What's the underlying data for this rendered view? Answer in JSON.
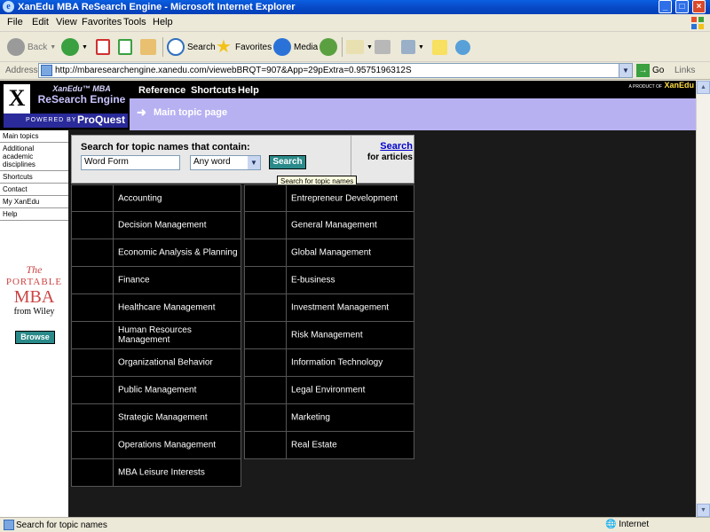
{
  "window": {
    "title": "XanEdu MBA ReSearch Engine - Microsoft Internet Explorer"
  },
  "menu": [
    "File",
    "Edit",
    "View",
    "Favorites",
    "Tools",
    "Help"
  ],
  "toolbar": {
    "back": "Back",
    "search": "Search",
    "favorites": "Favorites",
    "media": "Media"
  },
  "address": {
    "label": "Address",
    "url": "http://mbaresearchengine.xanedu.com/viewebBRQT=907&App=29pExtra=0.9575196312S",
    "go": "Go",
    "links": "Links"
  },
  "header": {
    "brand_top": "XanEdu™ MBA",
    "brand_name": "ReSearch Engine",
    "powered_by": "POWERED BY",
    "proquest": "ProQuest",
    "nav": [
      "Reference",
      "Shortcuts",
      "Help"
    ],
    "xanedu_prefix": "A PRODUCT OF",
    "xanedu": "XanEdu",
    "page_label": "Main topic page"
  },
  "leftnav": {
    "links": [
      "Main topics",
      "Additional academic disciplines",
      "Shortcuts",
      "Contact",
      "My XanEdu",
      "Help"
    ],
    "promo": {
      "the": "The",
      "portable": "PORTABLE",
      "mba": "MBA",
      "from": "from Wiley"
    },
    "browse": "Browse"
  },
  "search": {
    "label": "Search for topic names that contain:",
    "query": "Word Form",
    "mode": "Any word",
    "button": "Search",
    "articles_link": "Search",
    "articles_text": "for articles",
    "tooltip": "Search for topic names"
  },
  "topics_left": [
    "Accounting",
    "Decision Management",
    "Economic Analysis & Planning",
    "Finance",
    "Healthcare Management",
    "Human Resources Management",
    "Organizational Behavior",
    "Public Management",
    "Strategic Management",
    "Operations Management",
    "MBA Leisure Interests"
  ],
  "topics_right": [
    "Entrepreneur Development",
    "General Management",
    "Global Management",
    "E-business",
    "Investment Management",
    "Risk Management",
    "Information Technology",
    "Legal Environment",
    "Marketing",
    "Real Estate"
  ],
  "status": {
    "text": "Search for topic names",
    "zone": "Internet"
  },
  "colors": {
    "band": "#b7b1f2",
    "button_teal": "#2a8a8a",
    "titlebar_blue": "#0a5fe0"
  }
}
